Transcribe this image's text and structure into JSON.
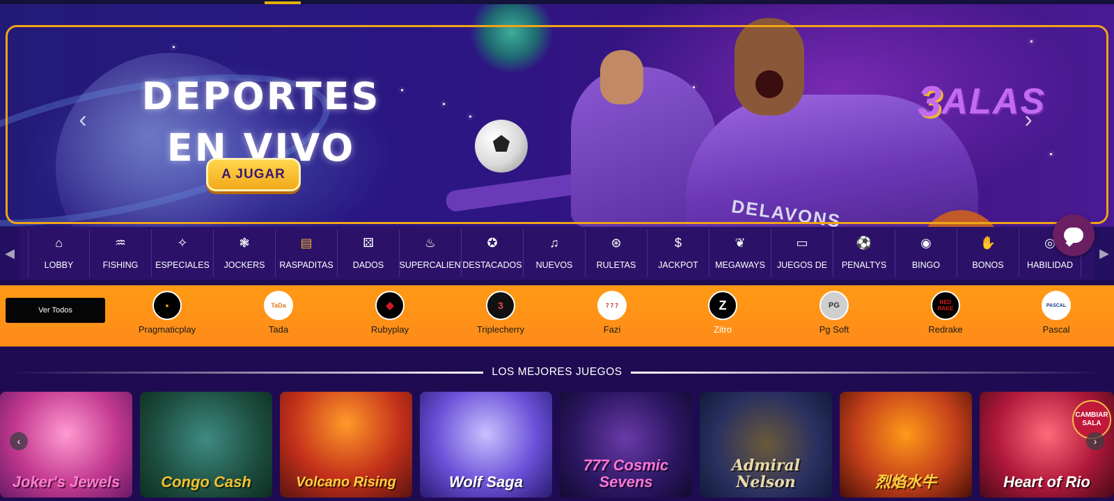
{
  "hero": {
    "title_line1": "DEPORTES",
    "title_line2": "EN VIVO",
    "cta_label": "A JUGAR",
    "brand_number": "3",
    "brand_name": "ALAS",
    "jersey_text": "DELAVONS",
    "prev_glyph": "‹",
    "next_glyph": "›"
  },
  "categories": {
    "scroll_left_glyph": "◀",
    "scroll_right_glyph": "▶",
    "items": [
      {
        "label": "LOBBY",
        "icon": "home-icon",
        "glyph": "⌂"
      },
      {
        "label": "FISHING",
        "icon": "fish-icon",
        "glyph": "♒"
      },
      {
        "label": "ESPECIALES",
        "icon": "sparkle-icon",
        "glyph": "✧"
      },
      {
        "label": "JOCKERS",
        "icon": "joker-icon",
        "glyph": "❃"
      },
      {
        "label": "RASPADITAS",
        "icon": "scratch-card-icon",
        "glyph": "▤"
      },
      {
        "label": "DADOS",
        "icon": "dice-icon",
        "glyph": "⚄"
      },
      {
        "label": "SUPERCALIENTES",
        "icon": "fire-icon",
        "glyph": "♨"
      },
      {
        "label": "DESTACADOS",
        "icon": "award-icon",
        "glyph": "✪"
      },
      {
        "label": "NUEVOS",
        "icon": "bell-icon",
        "glyph": "♫"
      },
      {
        "label": "RULETAS",
        "icon": "roulette-icon",
        "glyph": "⊛"
      },
      {
        "label": "JACKPOT",
        "icon": "money-bag-icon",
        "glyph": "$"
      },
      {
        "label": "MEGAWAYS",
        "icon": "megaways-icon",
        "glyph": "❦"
      },
      {
        "label": "JUEGOS DE",
        "icon": "table-game-icon",
        "glyph": "▭"
      },
      {
        "label": "PENALTYS",
        "icon": "soccer-ball-icon",
        "glyph": "⚽"
      },
      {
        "label": "BINGO",
        "icon": "bingo-ball-icon",
        "glyph": "◉"
      },
      {
        "label": "BONOS",
        "icon": "bonus-hand-icon",
        "glyph": "✋"
      },
      {
        "label": "HABILIDAD",
        "icon": "skill-icon",
        "glyph": "◎"
      }
    ]
  },
  "providers": {
    "ver_todos_label": "Ver Todos",
    "items": [
      {
        "name": "Pragmaticplay",
        "icon": "pragmaticplay-logo",
        "logo_text": "●",
        "bg": "#000000",
        "fg": "#ff9a14"
      },
      {
        "name": "Tada",
        "icon": "tada-logo",
        "logo_text": "TaDa",
        "bg": "#ffffff",
        "fg": "#e07b1a"
      },
      {
        "name": "Rubyplay",
        "icon": "rubyplay-logo",
        "logo_text": "◆",
        "bg": "#000000",
        "fg": "#d01a2a"
      },
      {
        "name": "Triplecherry",
        "icon": "triplecherry-logo",
        "logo_text": "3",
        "bg": "#111111",
        "fg": "#e84a4a"
      },
      {
        "name": "Fazi",
        "icon": "fazi-logo",
        "logo_text": "7 7 7",
        "bg": "#ffffff",
        "fg": "#c41a1a"
      },
      {
        "name": "Zitro",
        "icon": "zitro-logo",
        "logo_text": "Z",
        "bg": "#000000",
        "fg": "#ffffff"
      },
      {
        "name": "Pg Soft",
        "icon": "pg-soft-logo",
        "logo_text": "PG",
        "bg": "#cfcfcf",
        "fg": "#333333"
      },
      {
        "name": "Redrake",
        "icon": "redrake-logo",
        "logo_text": "RED RAKE",
        "bg": "#000000",
        "fg": "#e01a1a"
      },
      {
        "name": "Pascal",
        "icon": "pascal-logo",
        "logo_text": "PASCAL",
        "bg": "#ffffff",
        "fg": "#1a3a8a"
      }
    ]
  },
  "section": {
    "title": "LOS MEJORES JUEGOS"
  },
  "games": {
    "items": [
      {
        "title": "Joker's Jewels"
      },
      {
        "title": "Congo Cash"
      },
      {
        "title": "Volcano Rising"
      },
      {
        "title": "Wolf Saga"
      },
      {
        "title": "777 Cosmic Sevens"
      },
      {
        "title": "Admiral Nelson"
      },
      {
        "title": "烈焰水牛"
      },
      {
        "title": "Heart of Rio"
      }
    ],
    "cambiar_sala_label": "CAMBIAR SALA",
    "prev_glyph": "‹",
    "next_glyph": "›"
  },
  "colors": {
    "page_bg": "#1e0b52",
    "accent_orange": "#ff9a14",
    "frame_gold": "#f0a418",
    "category_bar": "#2b1268"
  }
}
